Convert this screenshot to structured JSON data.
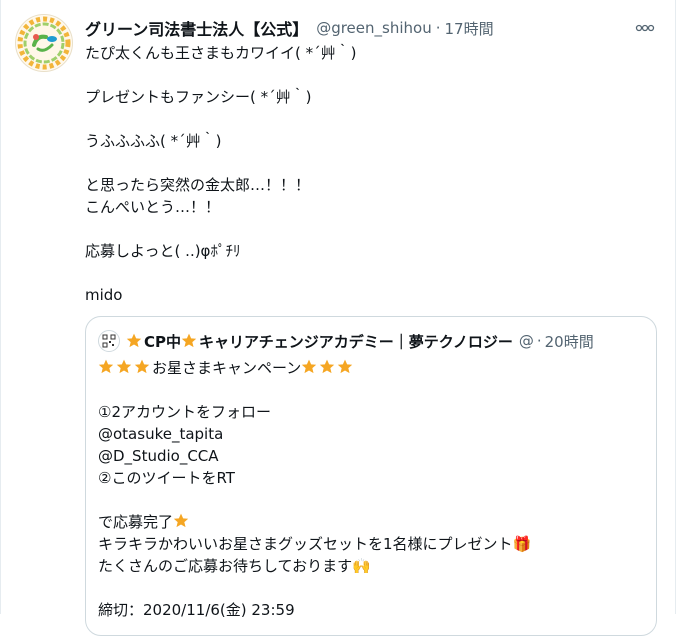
{
  "tweet": {
    "display_name": "グリーン司法書士法人【公式】",
    "handle": "@green_shihou",
    "separator": "·",
    "time": "17時間",
    "more_label": "ooo",
    "paragraphs": [
      "たぴ太くんも王さまもカワイイ( *´艸｀)",
      "プレゼントもファンシー( *´艸｀)",
      "うふふふふ( *´艸｀)",
      "と思ったら突然の金太郎…！！！\nこんぺいとう…！！",
      "応募しよっと( ..)φﾎﾟﾁﾘ",
      "mido"
    ]
  },
  "quote": {
    "name_prefix": "CP中",
    "name_suffix": "キャリアチェンジアカデミー｜夢テクノロジー",
    "handle": "@",
    "separator": "·",
    "time": "20時間",
    "line1": "お星さまキャンペーン",
    "line2": "①2アカウントをフォロー",
    "line3": " @otasuke_tapita",
    "line4": " @D_Studio_CCA",
    "line5": "②このツイートをRT",
    "line6": "で応募完了",
    "line7": "キラキラかわいいお星さまグッズセットを1名様にプレゼント",
    "line8": "たくさんのご応募お待ちしております",
    "line9": "締切：2020/11/6(金) 23:59",
    "gift_emoji": "🎁",
    "hands_emoji": "🙌"
  },
  "colors": {
    "star": "#f5a623",
    "muted": "#536471",
    "border": "#cfd9de"
  },
  "icons": {
    "avatar": "green-circle-logo-icon",
    "quote_avatar": "qr-code-icon",
    "star": "star-emoji-icon",
    "gift": "gift-emoji-icon",
    "hands": "raising-hands-emoji-icon"
  }
}
